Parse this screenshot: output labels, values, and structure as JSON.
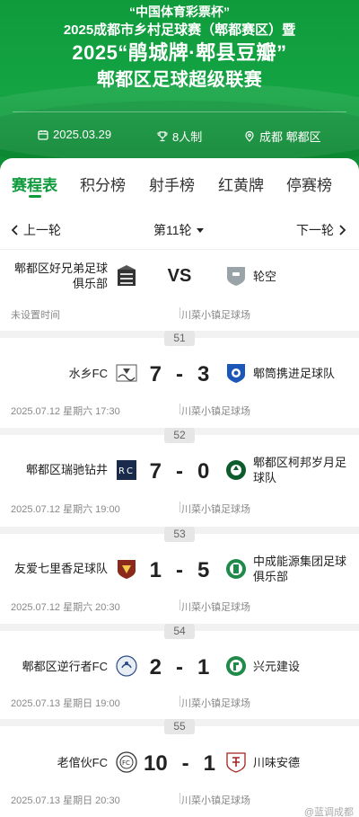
{
  "header": {
    "line1": "“中国体育彩票杯”",
    "line2": "2025成都市乡村足球赛（郫都赛区）暨",
    "line3": "2025“鹃城牌·郫县豆瓣”",
    "line4": "郫都区足球超级联赛",
    "date": "2025.03.29",
    "format": "8人制",
    "location": "成都 郫都区"
  },
  "tabs": [
    {
      "label": "赛程表",
      "active": true
    },
    {
      "label": "积分榜"
    },
    {
      "label": "射手榜"
    },
    {
      "label": "红黄牌"
    },
    {
      "label": "停赛榜"
    }
  ],
  "round": {
    "prev": "上一轮",
    "current": "第11轮",
    "next": "下一轮"
  },
  "matches": [
    {
      "number": "",
      "home": "郫都区好兄弟足球俱乐部",
      "away": "轮空",
      "home_score": "",
      "away_score": "",
      "vs": "VS",
      "time": "未设置时间",
      "venue": "川菜小镇足球场"
    },
    {
      "number": "51",
      "home": "水乡FC",
      "away": "郫筒携进足球队",
      "home_score": "7",
      "dash": "-",
      "away_score": "3",
      "time": "2025.07.12 星期六 17:30",
      "venue": "川菜小镇足球场"
    },
    {
      "number": "52",
      "home": "郫都区瑞驰钻井",
      "away": "郫都区柯邦岁月足球队",
      "home_score": "7",
      "dash": "-",
      "away_score": "0",
      "time": "2025.07.12 星期六 19:00",
      "venue": "川菜小镇足球场"
    },
    {
      "number": "53",
      "home": "友爱七里香足球队",
      "away": "中成能源集团足球俱乐部",
      "home_score": "1",
      "dash": "-",
      "away_score": "5",
      "time": "2025.07.12 星期六 20:30",
      "venue": "川菜小镇足球场"
    },
    {
      "number": "54",
      "home": "郫都区逆行者FC",
      "away": "兴元建设",
      "home_score": "2",
      "dash": "-",
      "away_score": "1",
      "time": "2025.07.13 星期日 19:00",
      "venue": "川菜小镇足球场"
    },
    {
      "number": "55",
      "home": "老倌伙FC",
      "away": "川味安德",
      "home_score": "10",
      "dash": "-",
      "away_score": "1",
      "time": "2025.07.13 星期日 20:30",
      "venue": "川菜小镇足球场"
    }
  ],
  "watermark": "@蓝调成都",
  "colors": {
    "brand_green": "#0f9b3c",
    "separator": "#f2f2f2"
  }
}
